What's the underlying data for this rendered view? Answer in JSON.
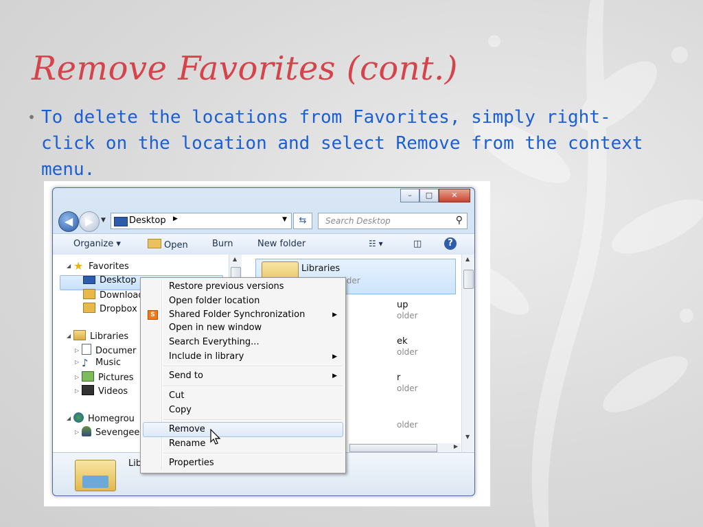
{
  "slide": {
    "title": "Remove Favorites (cont.)",
    "bullet": "To delete the locations from Favorites, simply right-click on the location and select Remove from the context menu."
  },
  "window": {
    "caption_buttons": {
      "minimize": "–",
      "maximize": "□",
      "close": "✕"
    },
    "address": {
      "location": "Desktop",
      "search_placeholder": "Search Desktop"
    },
    "toolbar": {
      "organize": "Organize ▾",
      "open": "Open",
      "burn": "Burn",
      "new_folder": "New folder"
    },
    "tree": {
      "favorites": "Favorites",
      "desktop": "Desktop",
      "downloads": "Download",
      "dropbox": "Dropbox",
      "libraries": "Libraries",
      "documents": "Documer",
      "music": "Music",
      "pictures": "Pictures",
      "videos": "Videos",
      "homegroup": "Homegrou",
      "user": "Sevengee"
    },
    "content": {
      "items": [
        {
          "name": "Libraries",
          "sub": "System Folder"
        },
        {
          "name": "up",
          "sub": "older"
        },
        {
          "name": "ek",
          "sub": "older"
        },
        {
          "name": "r",
          "sub": "older"
        },
        {
          "name": "",
          "sub": "older"
        }
      ]
    },
    "details": {
      "label": "Lib"
    }
  },
  "context_menu": {
    "items": [
      "Restore previous versions",
      "Open folder location",
      "Shared Folder Synchronization",
      "Open in new window",
      "Search Everything...",
      "Include in library",
      "Send to",
      "Cut",
      "Copy",
      "Remove",
      "Rename",
      "Properties"
    ],
    "highlighted": "Remove",
    "icon_letter": "S"
  },
  "colors": {
    "title": "#d4444a",
    "bullet": "#1a5fd6"
  }
}
